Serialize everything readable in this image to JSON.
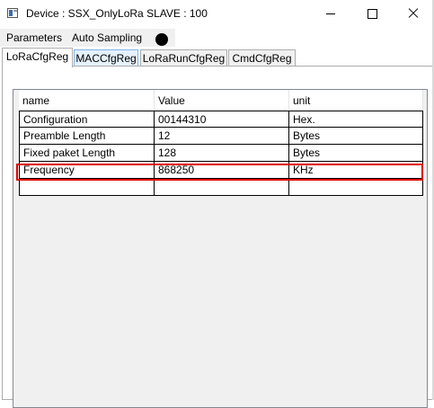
{
  "window": {
    "title": "Device : SSX_OnlyLoRa SLAVE : 100",
    "icons": {
      "app": "app-window-icon",
      "minimize": "minimize-icon",
      "maximize": "maximize-icon",
      "close": "close-icon"
    }
  },
  "menu": {
    "items": [
      "Parameters",
      "Auto Sampling"
    ],
    "status_indicator": "status-dot-icon",
    "status_color": "#000000"
  },
  "tabs": [
    {
      "label": "LoRaCfgReg",
      "active": true
    },
    {
      "label": "MACCfgReg",
      "active": false
    },
    {
      "label": "LoRaRunCfgReg",
      "active": false
    },
    {
      "label": "CmdCfgReg",
      "active": false
    }
  ],
  "grid": {
    "columns": [
      "name",
      "Value",
      "unit"
    ],
    "rows": [
      {
        "name": "Configuration",
        "value": "00144310",
        "unit": "Hex."
      },
      {
        "name": "Preamble Length",
        "value": "12",
        "unit": "Bytes"
      },
      {
        "name": "Fixed paket Length",
        "value": "128",
        "unit": "Bytes"
      },
      {
        "name": "Frequency",
        "value": "868250",
        "unit": "KHz"
      },
      {
        "name": "",
        "value": "",
        "unit": ""
      }
    ],
    "highlighted_row": "Frequency",
    "highlight_color": "#e00000"
  }
}
